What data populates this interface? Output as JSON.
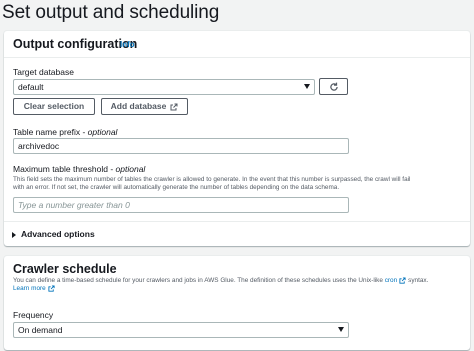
{
  "page": {
    "title": "Set output and scheduling"
  },
  "output": {
    "title": "Output configuration",
    "info": "Info",
    "target_db_label": "Target database",
    "target_db_value": "default",
    "clear_selection": "Clear selection",
    "add_database": "Add database",
    "prefix_label": "Table name prefix",
    "prefix_optional": "optional",
    "prefix_value": "archivedoc",
    "threshold_label": "Maximum table threshold",
    "threshold_optional": "optional",
    "threshold_desc_1": "This field sets the maximum number of tables the crawler is allowed to generate. In the event that this number is surpassed, the crawl will fail",
    "threshold_desc_2": "with an error. If not set, the crawler will automatically generate the number of tables depending on the data schema.",
    "threshold_placeholder": "Type a number greater than 0",
    "advanced": "Advanced options"
  },
  "schedule": {
    "title": "Crawler schedule",
    "desc_1": "You can define a time-based schedule for your crawlers and jobs in AWS Glue. The definition of these schedules uses the Unix-like",
    "cron_link": "cron",
    "desc_2": "syntax.",
    "learn_more": "Learn more",
    "frequency_label": "Frequency",
    "frequency_value": "On demand"
  },
  "colors": {
    "link": "#0073bb",
    "border": "#aab7b8",
    "text": "#16191f",
    "secondary": "#545b64"
  },
  "icons": [
    "refresh-icon",
    "external-link-icon",
    "caret-down-icon",
    "caret-right-icon"
  ]
}
